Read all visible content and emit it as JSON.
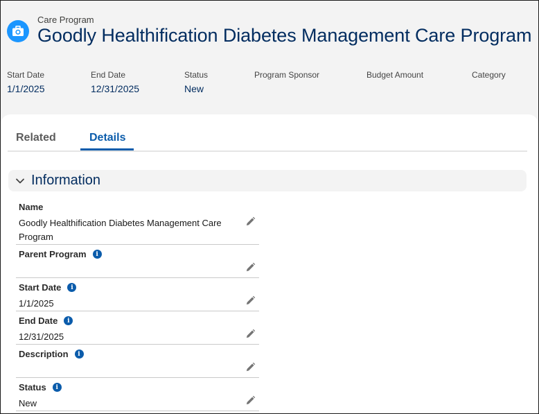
{
  "header": {
    "icon": "care-program-icon",
    "object_label": "Care Program",
    "title": "Goodly Healthification Diabetes Management Care Program"
  },
  "highlights": [
    {
      "label": "Start Date",
      "value": "1/1/2025"
    },
    {
      "label": "End Date",
      "value": "12/31/2025"
    },
    {
      "label": "Status",
      "value": "New"
    },
    {
      "label": "Program Sponsor",
      "value": ""
    },
    {
      "label": "Budget Amount",
      "value": ""
    },
    {
      "label": "Category",
      "value": ""
    }
  ],
  "tabs": [
    {
      "label": "Related",
      "active": false
    },
    {
      "label": "Details",
      "active": true
    }
  ],
  "section": {
    "title": "Information",
    "expanded": true
  },
  "fields": [
    {
      "label": "Name",
      "value": "Goodly Healthification Diabetes Management Care Program",
      "has_info": false
    },
    {
      "label": "Parent Program",
      "value": "",
      "has_info": true
    },
    {
      "label": "Start Date",
      "value": "1/1/2025",
      "has_info": true
    },
    {
      "label": "End Date",
      "value": "12/31/2025",
      "has_info": true
    },
    {
      "label": "Description",
      "value": "",
      "has_info": true
    },
    {
      "label": "Status",
      "value": "New",
      "has_info": true
    }
  ],
  "colors": {
    "accent": "#0b5cab",
    "title": "#032d60",
    "icon_bg": "#1b96ff"
  }
}
